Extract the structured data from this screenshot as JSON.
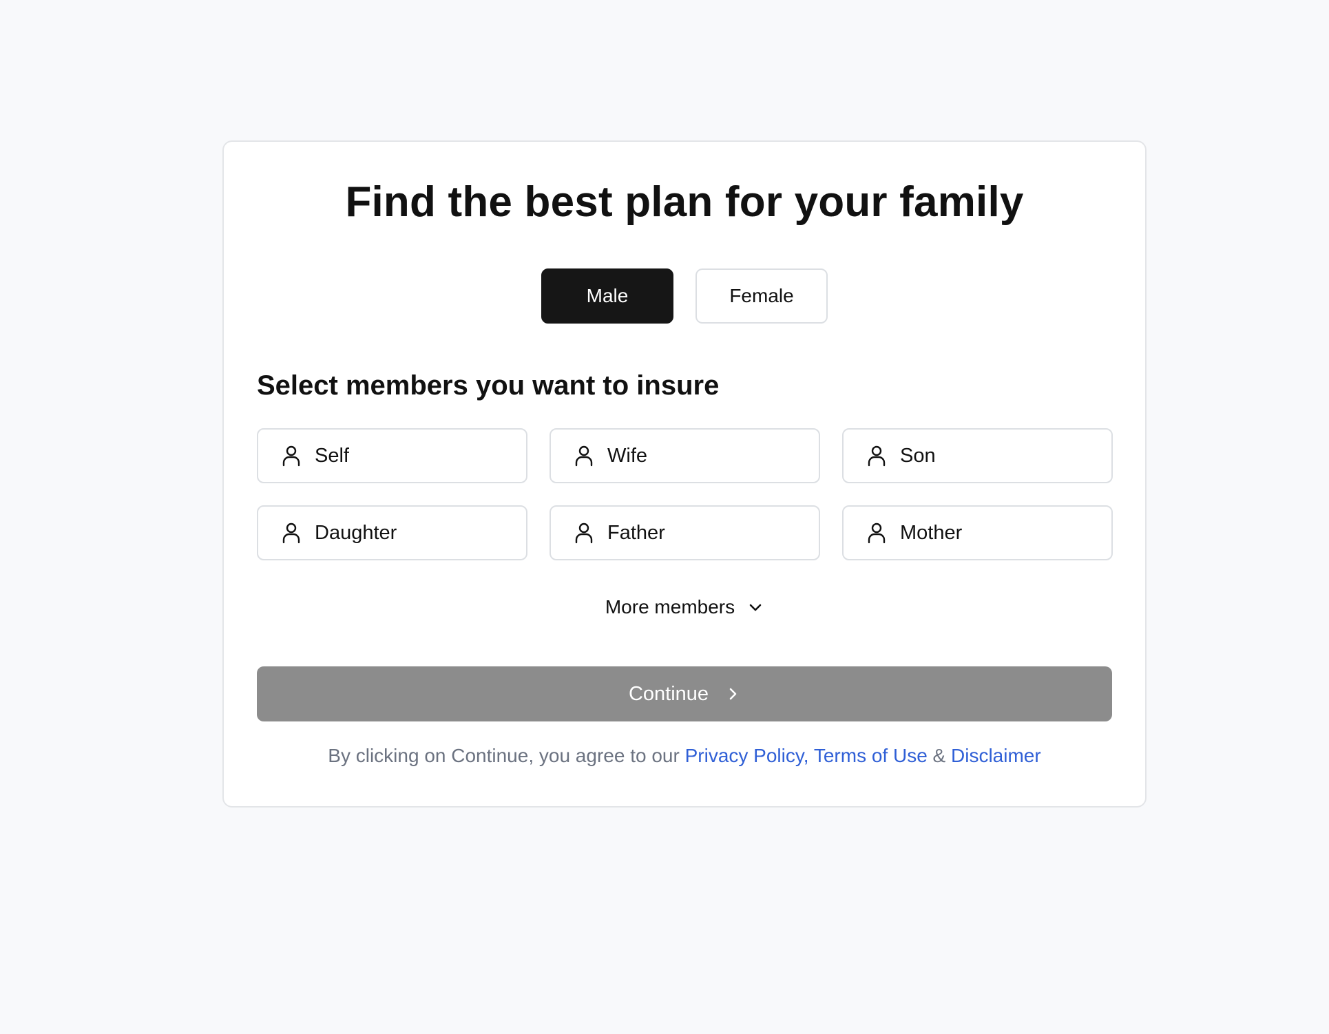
{
  "page": {
    "title": "Find the best plan for your family"
  },
  "gender": {
    "options": [
      {
        "label": "Male",
        "selected": true
      },
      {
        "label": "Female",
        "selected": false
      }
    ]
  },
  "members": {
    "heading": "Select members you want to insure",
    "items": [
      {
        "label": "Self",
        "icon": "person-icon"
      },
      {
        "label": "Wife",
        "icon": "person-icon"
      },
      {
        "label": "Son",
        "icon": "person-icon"
      },
      {
        "label": "Daughter",
        "icon": "person-icon"
      },
      {
        "label": "Father",
        "icon": "person-icon"
      },
      {
        "label": "Mother",
        "icon": "person-icon"
      }
    ],
    "more_label": "More members"
  },
  "actions": {
    "continue_label": "Continue",
    "continue_enabled": false
  },
  "footer": {
    "prefix": "By clicking on Continue, you agree to our ",
    "privacy_label": "Privacy Policy,",
    "space": " ",
    "terms_label": "Terms of Use",
    "amp": " & ",
    "disclaimer_label": "Disclaimer"
  },
  "colors": {
    "background": "#f8f9fb",
    "primary_dark": "#161616",
    "disabled_button": "#8c8c8c",
    "link": "#2f5fd6",
    "muted_text": "#6b7280"
  }
}
